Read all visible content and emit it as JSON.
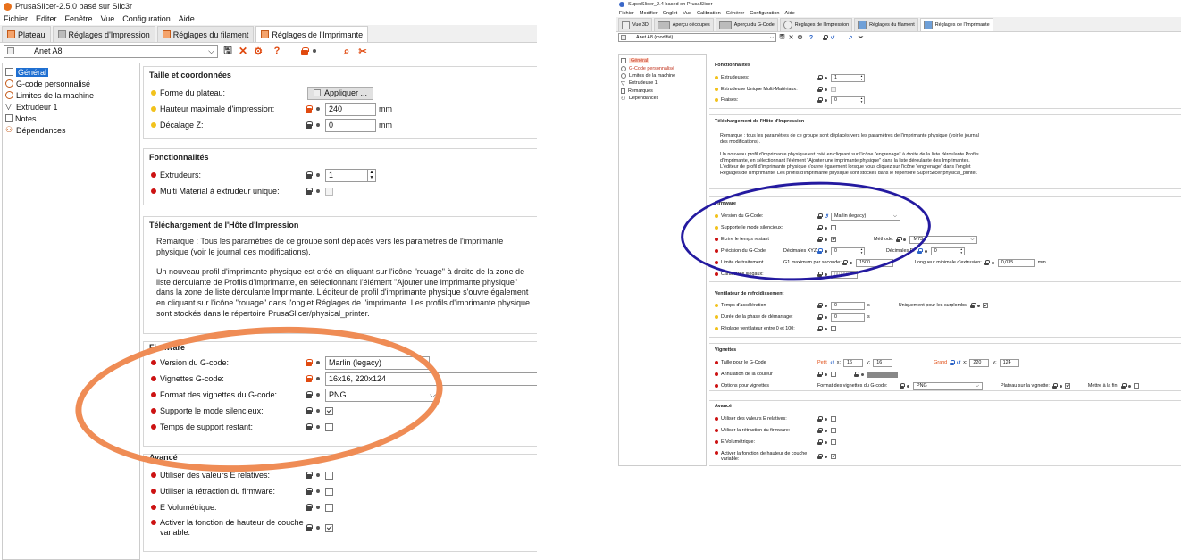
{
  "left": {
    "title": "PrusaSlicer-2.5.0 basé sur Slic3r",
    "menu": [
      "Fichier",
      "Editer",
      "Fenêtre",
      "Vue",
      "Configuration",
      "Aide"
    ],
    "tabs": [
      "Plateau",
      "Réglages d'Impression",
      "Réglages du filament",
      "Réglages de l'Imprimante"
    ],
    "preset": "Anet A8",
    "toolbar_help": "?",
    "nav": [
      "Général",
      "G-code personnalisé",
      "Limites de la machine",
      "Extrudeur 1",
      "Notes",
      "Dépendances"
    ],
    "sec_size": {
      "title": "Taille et coordonnées",
      "bed_shape_label": "Forme du plateau:",
      "bed_shape_button": "Appliquer ...",
      "max_height_label": "Hauteur maximale d'impression:",
      "max_height_value": "240",
      "z_offset_label": "Décalage Z:",
      "z_offset_value": "0",
      "unit": "mm"
    },
    "sec_caps": {
      "title": "Fonctionnalités",
      "extruders_label": "Extrudeurs:",
      "extruders_value": "1",
      "multimat_label": "Multi Material à extrudeur unique:"
    },
    "sec_host": {
      "title": "Téléchargement de l'Hôte d'Impression",
      "note1": "Remarque : Tous les paramètres de ce groupe sont déplacés vers les paramètres de l'imprimante physique (voir le journal des modifications).",
      "note2": "Un nouveau profil d'imprimante physique est créé en cliquant sur l'icône \"rouage\" à droite de la zone de liste déroulante de Profils d'imprimante, en sélectionnant l'élément \"Ajouter une imprimante physique\" dans la zone de liste déroulante Imprimante. L'éditeur de profil d'imprimante physique s'ouvre également en cliquant sur l'icône \"rouage\" dans l'onglet Réglages de l'imprimante. Les profils d'imprimante physique sont stockés dans le répertoire PrusaSlicer/physical_printer."
    },
    "sec_fw": {
      "title": "Firmware",
      "flavor_label": "Version du G-code:",
      "flavor_value": "Marlin (legacy)",
      "thumbs_label": "Vignettes G-code:",
      "thumbs_value": "16x16, 220x124",
      "thumbfmt_label": "Format des vignettes du G-code:",
      "thumbfmt_value": "PNG",
      "silent_label": "Supporte le mode silencieux:",
      "remaining_label": "Temps de support restant:"
    },
    "sec_adv": {
      "title": "Avancé",
      "rel_e_label": "Utiliser des valeurs E relatives:",
      "fw_retract_label": "Utiliser la rétraction du firmware:",
      "vol_e_label": "E Volumétrique:",
      "var_layer_label": "Activer la fonction de hauteur de couche variable:"
    }
  },
  "right": {
    "title": "SuperSlicer_2.4  based on PrusaSlicer",
    "menu": [
      "Fichier",
      "Modifier",
      "Onglet",
      "Vue",
      "Calibration",
      "Générer",
      "Configuration",
      "Aide"
    ],
    "tabs": [
      "Vue 3D",
      "Aperçu découpes",
      "Aperçu du G-Code",
      "Réglages de l'Impression",
      "Réglages du filament",
      "Réglages de l'Imprimante"
    ],
    "preset": "Anet A8 (modifié)",
    "toolbar_help": "?",
    "nav": [
      "Général",
      "G-Code personnalisé",
      "Limites de la machine",
      "Extrudeuse 1",
      "Remarques",
      "Dépendances"
    ],
    "sec_caps": {
      "title": "Fonctionnalités",
      "extruders_label": "Extrudeuses:",
      "extruders_value": "1",
      "single_multi_label": "Extrudeuse Unique Multi-Matériaux:",
      "mills_label": "Fraises:",
      "mills_value": "0"
    },
    "sec_host": {
      "title": "Téléchargement de l'Hôte d'Impression",
      "note1": "Remarque : tous les paramètres de ce groupe sont déplacés vers les paramètres de l'imprimante physique (voir le journal des modifications).",
      "note2": "Un nouveau profil d'imprimante physique est créé en cliquant sur l'icône \"engrenage\" à droite de la liste déroulante Profils d'imprimante, en sélectionnant l'élément \"Ajouter une imprimante physique\" dans la liste déroulante des Imprimantes. L'éditeur de profil d'imprimante physique s'ouvre également lorsque vous cliquez sur l'icône \"engrenage\" dans l'onglet Réglages de l'Imprimante. Les profils d'imprimante physique sont stockés dans le répertoire SuperSlicer/physical_printer."
    },
    "sec_fw": {
      "title": "Firmware",
      "flavor_label": "Version du G-Code:",
      "flavor_value": "Marlin (legacy)",
      "silent_label": "Supporte le mode silencieux:",
      "remaining_label": "Ecrire le temps restant",
      "method_label": "Méthode:",
      "method_value": "M73",
      "precision_label": "Précision du G-Code",
      "dec_xyz_label": "Décimales XYZ:",
      "dec_xyz_value": "0",
      "dec_e_label": "Décimales E:",
      "dec_e_value": "0",
      "limit_label": "Limite de traitement",
      "g1_label": "G1 maximum par seconde:",
      "g1_value": "1500",
      "min_len_label": "Longueur minimale d'extrusion:",
      "min_len_value": "0,035",
      "unit": "mm",
      "illegal_label": "Caractères illégaux:",
      "illegal_value": "[\\(\\)\\[\\]]"
    },
    "sec_fan": {
      "title": "Ventilateur de refroidissement",
      "accel_label": "Temps d'accélération",
      "accel_value": "0",
      "unit": "s",
      "overhang_label": "Uniquement pour les surplombs:",
      "kick_label": "Durée de la phase de démarrage:",
      "kick_value": "0",
      "percent_label": "Réglage ventilateur entre 0 et 100:"
    },
    "sec_thumb": {
      "title": "Vignettes",
      "size_label": "Taille pour le G-Code",
      "small_label": "Petit",
      "x_label": "x:",
      "y_label": "y:",
      "small_x": "16",
      "small_y": "16",
      "big_label": "Grand",
      "big_x": "220",
      "big_y": "124",
      "color_label": "Annulation de la couleur",
      "options_label": "Options pour vignettes",
      "format_label": "Format des vignettes du G-code:",
      "format_value": "PNG",
      "bed_label": "Plateau sur la vignette:",
      "end_label": "Mettre à la fin:"
    },
    "sec_adv": {
      "title": "Avancé",
      "rel_e_label": "Utiliser des valeurs E relatives:",
      "fw_retract_label": "Utiliser la rétraction du firmware:",
      "vol_e_label": "E Volumétrique:",
      "var_layer_label": "Activer la fonction de hauteur de couche variable:"
    }
  },
  "colors": {
    "orange_highlight": "#ef8c55",
    "blue_highlight": "#241aa0",
    "selection": "#1f6fd1",
    "expert_dot": "#cc1212",
    "simple_dot": "#f2c21c"
  }
}
